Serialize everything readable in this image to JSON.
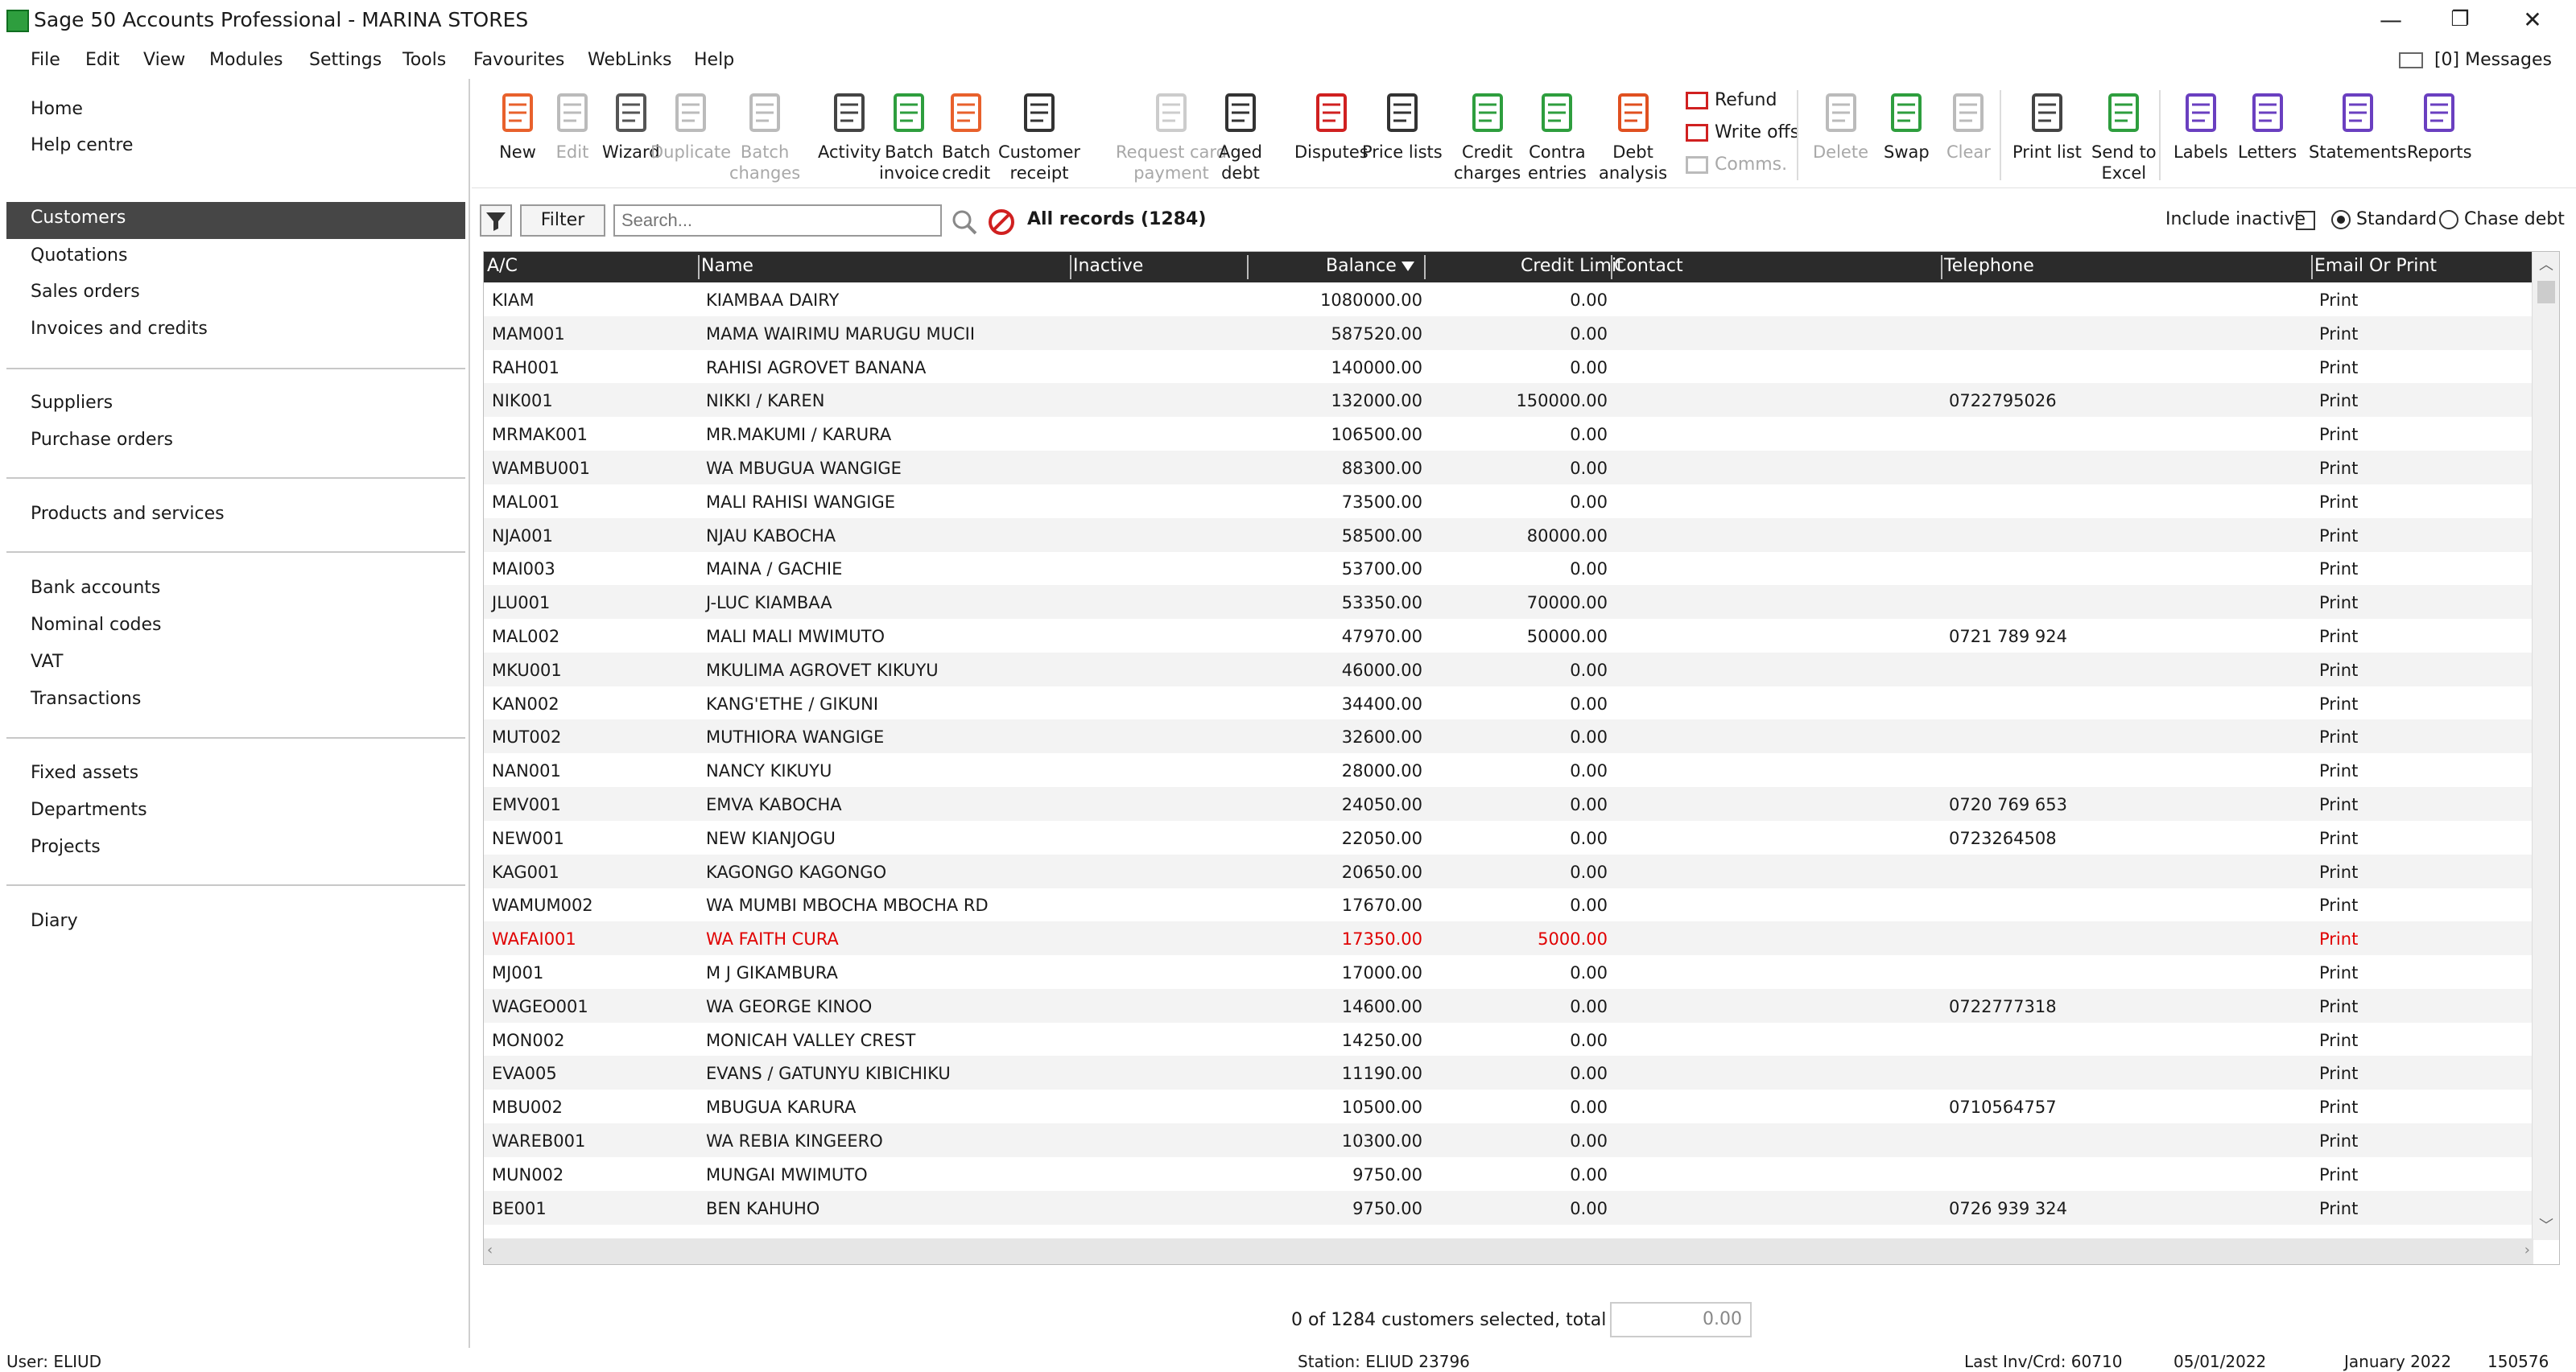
{
  "window": {
    "title": "Sage 50 Accounts Professional - MARINA STORES",
    "minimize": "—",
    "restore": "❐",
    "close": "✕"
  },
  "menu": {
    "items": [
      "File",
      "Edit",
      "View",
      "Modules",
      "Settings",
      "Tools",
      "Favourites",
      "WebLinks",
      "Help"
    ],
    "messages": "[0] Messages"
  },
  "sidebar": {
    "top": [
      "Home",
      "Help centre"
    ],
    "selected": "Customers",
    "group1": [
      "Quotations",
      "Sales orders",
      "Invoices and credits"
    ],
    "group2": [
      "Suppliers",
      "Purchase orders"
    ],
    "group3": [
      "Products and services"
    ],
    "group4": [
      "Bank accounts",
      "Nominal codes",
      "VAT",
      "Transactions"
    ],
    "group5": [
      "Fixed assets",
      "Departments",
      "Projects"
    ],
    "group6": [
      "Diary"
    ]
  },
  "toolbar": {
    "buttons": [
      {
        "label": "New",
        "icon": "person-add-icon",
        "enabled": true
      },
      {
        "label": "Edit",
        "icon": "person-edit-icon",
        "enabled": false
      },
      {
        "label": "Wizard",
        "icon": "wand-icon",
        "enabled": true
      },
      {
        "label": "Duplicate",
        "icon": "people-icon",
        "enabled": false
      },
      {
        "label": "Batch\nchanges",
        "icon": "batch-changes-icon",
        "enabled": false
      },
      {
        "label": "Activity",
        "icon": "activity-arrows-icon",
        "enabled": true
      },
      {
        "label": "Batch\ninvoice",
        "icon": "batch-invoice-icon",
        "enabled": true
      },
      {
        "label": "Batch\ncredit",
        "icon": "batch-credit-icon",
        "enabled": true
      },
      {
        "label": "Customer\nreceipt",
        "icon": "bank-icon",
        "enabled": true
      },
      {
        "label": "Request card\npayment",
        "icon": "card-icon",
        "enabled": false
      },
      {
        "label": "Aged\ndebt",
        "icon": "bar-chart-icon",
        "enabled": true
      },
      {
        "label": "Disputes",
        "icon": "flag-icon",
        "enabled": true
      },
      {
        "label": "Price lists",
        "icon": "price-list-icon",
        "enabled": true
      },
      {
        "label": "Credit\ncharges",
        "icon": "credit-charges-icon",
        "enabled": true
      },
      {
        "label": "Contra\nentries",
        "icon": "contra-icon",
        "enabled": true
      },
      {
        "label": "Debt\nanalysis",
        "icon": "debt-analysis-icon",
        "enabled": true
      }
    ],
    "refund": "Refund",
    "write_offs": "Write offs",
    "comms": "Comms.",
    "buttons2": [
      {
        "label": "Delete",
        "icon": "person-delete-icon",
        "enabled": false
      },
      {
        "label": "Swap",
        "icon": "swap-icon",
        "enabled": true
      },
      {
        "label": "Clear",
        "icon": "clear-icon",
        "enabled": false
      }
    ],
    "buttons3": [
      {
        "label": "Print list",
        "icon": "printer-icon",
        "enabled": true
      },
      {
        "label": "Send to\nExcel",
        "icon": "excel-icon",
        "enabled": true
      }
    ],
    "buttons4": [
      {
        "label": "Labels",
        "icon": "labels-icon",
        "enabled": true
      },
      {
        "label": "Letters",
        "icon": "letters-icon",
        "enabled": true
      },
      {
        "label": "Statements",
        "icon": "statements-icon",
        "enabled": true
      },
      {
        "label": "Reports",
        "icon": "reports-icon",
        "enabled": true
      }
    ]
  },
  "filter": {
    "button": "Filter",
    "search_placeholder": "Search...",
    "records": "All records (1284)",
    "include_inactive": "Include inactive",
    "standard": "Standard",
    "chase_debt": "Chase debt"
  },
  "table": {
    "columns": [
      "A/C",
      "Name",
      "Inactive",
      "Balance",
      "Credit Limit",
      "Contact",
      "Telephone",
      "Email Or Print"
    ],
    "rows": [
      [
        "KIAM",
        "KIAMBAA DAIRY",
        "",
        "1080000.00",
        "0.00",
        "",
        "",
        "Print"
      ],
      [
        "MAM001",
        "MAMA WAIRIMU MARUGU MUCII",
        "",
        "587520.00",
        "0.00",
        "",
        "",
        "Print"
      ],
      [
        "RAH001",
        "RAHISI AGROVET BANANA",
        "",
        "140000.00",
        "0.00",
        "",
        "",
        "Print"
      ],
      [
        "NIK001",
        "NIKKI  /  KAREN",
        "",
        "132000.00",
        "150000.00",
        "",
        "0722795026",
        "Print"
      ],
      [
        "MRMAK001",
        "MR.MAKUMI  /  KARURA",
        "",
        "106500.00",
        "0.00",
        "",
        "",
        "Print"
      ],
      [
        "WAMBU001",
        "WA MBUGUA WANGIGE",
        "",
        "88300.00",
        "0.00",
        "",
        "",
        "Print"
      ],
      [
        "MAL001",
        "MALI RAHISI WANGIGE",
        "",
        "73500.00",
        "0.00",
        "",
        "",
        "Print"
      ],
      [
        "NJA001",
        "NJAU KABOCHA",
        "",
        "58500.00",
        "80000.00",
        "",
        "",
        "Print"
      ],
      [
        "MAI003",
        "MAINA / GACHIE",
        "",
        "53700.00",
        "0.00",
        "",
        "",
        "Print"
      ],
      [
        "JLU001",
        "J-LUC KIAMBAA",
        "",
        "53350.00",
        "70000.00",
        "",
        "",
        "Print"
      ],
      [
        "MAL002",
        "MALI MALI MWIMUTO",
        "",
        "47970.00",
        "50000.00",
        "",
        "0721 789 924",
        "Print"
      ],
      [
        "MKU001",
        "MKULIMA AGROVET KIKUYU",
        "",
        "46000.00",
        "0.00",
        "",
        "",
        "Print"
      ],
      [
        "KAN002",
        "KANG'ETHE /  GIKUNI",
        "",
        "34400.00",
        "0.00",
        "",
        "",
        "Print"
      ],
      [
        "MUT002",
        "MUTHIORA WANGIGE",
        "",
        "32600.00",
        "0.00",
        "",
        "",
        "Print"
      ],
      [
        "NAN001",
        "NANCY KIKUYU",
        "",
        "28000.00",
        "0.00",
        "",
        "",
        "Print"
      ],
      [
        "EMV001",
        "EMVA KABOCHA",
        "",
        "24050.00",
        "0.00",
        "",
        "0720 769 653",
        "Print"
      ],
      [
        "NEW001",
        "NEW KIANJOGU",
        "",
        "22050.00",
        "0.00",
        "",
        "0723264508",
        "Print"
      ],
      [
        "KAG001",
        "KAGONGO KAGONGO",
        "",
        "20650.00",
        "0.00",
        "",
        "",
        "Print"
      ],
      [
        "WAMUM002",
        "WA MUMBI MBOCHA MBOCHA RD",
        "",
        "17670.00",
        "0.00",
        "",
        "",
        "Print"
      ],
      [
        "WAFAI001",
        "WA FAITH CURA",
        "",
        "17350.00",
        "5000.00",
        "",
        "",
        "Print"
      ],
      [
        "MJ001",
        "M J GIKAMBURA",
        "",
        "17000.00",
        "0.00",
        "",
        "",
        "Print"
      ],
      [
        "WAGEO001",
        "WA GEORGE KINOO",
        "",
        "14600.00",
        "0.00",
        "",
        "0722777318",
        "Print"
      ],
      [
        "MON002",
        "MONICAH VALLEY CREST",
        "",
        "14250.00",
        "0.00",
        "",
        "",
        "Print"
      ],
      [
        "EVA005",
        "EVANS /  GATUNYU KIBICHIKU",
        "",
        "11190.00",
        "0.00",
        "",
        "",
        "Print"
      ],
      [
        "MBU002",
        "MBUGUA KARURA",
        "",
        "10500.00",
        "0.00",
        "",
        "0710564757",
        "Print"
      ],
      [
        "WAREB001",
        "WA REBIA KINGEERO",
        "",
        "10300.00",
        "0.00",
        "",
        "",
        "Print"
      ],
      [
        "MUN002",
        "MUNGAI MWIMUTO",
        "",
        "9750.00",
        "0.00",
        "",
        "",
        "Print"
      ],
      [
        "BE001",
        "BEN KAHUHO",
        "",
        "9750.00",
        "0.00",
        "",
        "0726 939 324",
        "Print"
      ]
    ],
    "highlight_row": 19,
    "highlight_color": "#e00000"
  },
  "footer": {
    "selected": "0 of 1284 customers selected, total",
    "total": "0.00"
  },
  "status": {
    "user": "User: ELIUD",
    "station": "Station: ELIUD  23796",
    "last_inv": "Last Inv/Crd: 60710",
    "date": "05/01/2022",
    "period": "January 2022",
    "code": "150576"
  }
}
